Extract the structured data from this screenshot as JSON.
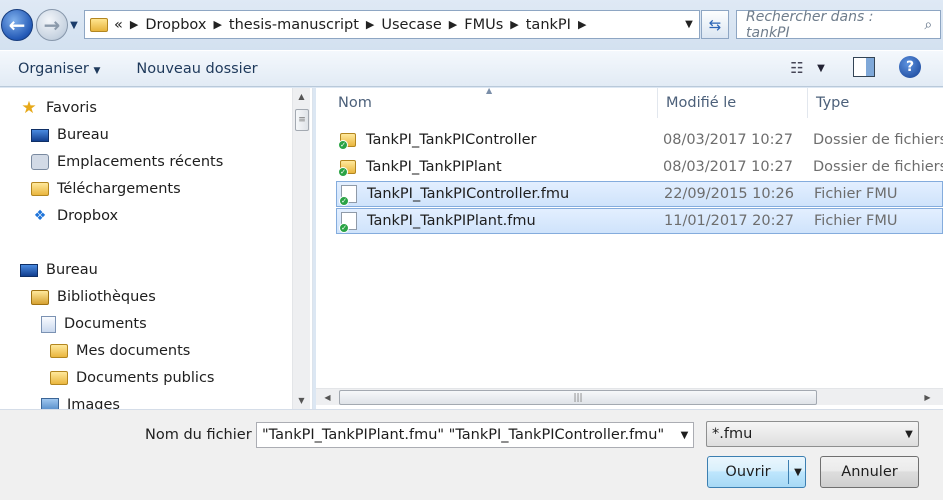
{
  "address": {
    "overflow_marker": "«",
    "crumbs": [
      "Dropbox",
      "thesis-manuscript",
      "Usecase",
      "FMUs",
      "tankPI"
    ]
  },
  "search": {
    "placeholder": "Rechercher dans : tankPI"
  },
  "toolbar": {
    "organize_label": "Organiser",
    "new_folder_label": "Nouveau dossier"
  },
  "nav": {
    "items": [
      {
        "label": "Favoris",
        "icon": "star-icon"
      },
      {
        "label": "Bureau",
        "icon": "desktop-icon"
      },
      {
        "label": "Emplacements récents",
        "icon": "recent-places-icon"
      },
      {
        "label": "Téléchargements",
        "icon": "downloads-folder-icon"
      },
      {
        "label": "Dropbox",
        "icon": "dropbox-icon"
      },
      {
        "label": "Bureau",
        "icon": "desktop-icon"
      },
      {
        "label": "Bibliothèques",
        "icon": "libraries-icon"
      },
      {
        "label": "Documents",
        "icon": "documents-icon"
      },
      {
        "label": "Mes documents",
        "icon": "folder-icon"
      },
      {
        "label": "Documents publics",
        "icon": "folder-icon"
      },
      {
        "label": "Images",
        "icon": "pictures-icon"
      }
    ]
  },
  "columns": {
    "name": "Nom",
    "modified": "Modifié le",
    "type": "Type"
  },
  "files": [
    {
      "name": "TankPI_TankPIController",
      "modified": "08/03/2017 10:27",
      "type": "Dossier de fichiers",
      "kind": "folder",
      "selected": false
    },
    {
      "name": "TankPI_TankPIPlant",
      "modified": "08/03/2017 10:27",
      "type": "Dossier de fichiers",
      "kind": "folder",
      "selected": false
    },
    {
      "name": "TankPI_TankPIController.fmu",
      "modified": "22/09/2015 10:26",
      "type": "Fichier FMU",
      "kind": "file",
      "selected": true
    },
    {
      "name": "TankPI_TankPIPlant.fmu",
      "modified": "11/01/2017 20:27",
      "type": "Fichier FMU",
      "kind": "file",
      "selected": true
    }
  ],
  "footer": {
    "filename_label": "Nom du fichier :",
    "filename_value": "\"TankPI_TankPIPlant.fmu\" \"TankPI_TankPIController.fmu\"",
    "filter_value": "*.fmu",
    "open_label": "Ouvrir",
    "cancel_label": "Annuler"
  }
}
